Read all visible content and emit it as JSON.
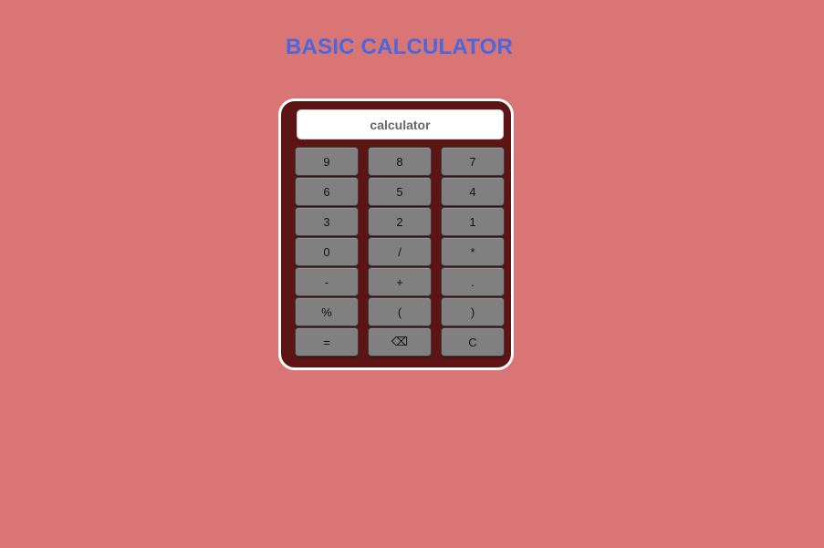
{
  "page": {
    "title": "BASIC CALCULATOR",
    "background_color": "#d97575",
    "title_color": "#4a67df"
  },
  "calculator": {
    "background_color": "#5c1414",
    "display": {
      "placeholder": "calculator",
      "value": ""
    },
    "keys": [
      {
        "label": "9",
        "name": "key-9"
      },
      {
        "label": "8",
        "name": "key-8"
      },
      {
        "label": "7",
        "name": "key-7"
      },
      {
        "label": "6",
        "name": "key-6"
      },
      {
        "label": "5",
        "name": "key-5"
      },
      {
        "label": "4",
        "name": "key-4"
      },
      {
        "label": "3",
        "name": "key-3"
      },
      {
        "label": "2",
        "name": "key-2"
      },
      {
        "label": "1",
        "name": "key-1"
      },
      {
        "label": "0",
        "name": "key-0"
      },
      {
        "label": "/",
        "name": "divide-button"
      },
      {
        "label": "*",
        "name": "multiply-button"
      },
      {
        "label": "-",
        "name": "subtract-button"
      },
      {
        "label": "+",
        "name": "add-button"
      },
      {
        "label": ".",
        "name": "decimal-button"
      },
      {
        "label": "%",
        "name": "percent-button"
      },
      {
        "label": "(",
        "name": "open-paren-button"
      },
      {
        "label": ")",
        "name": "close-paren-button"
      },
      {
        "label": "=",
        "name": "equals-button"
      },
      {
        "label": "⌫",
        "name": "backspace-button"
      },
      {
        "label": "C",
        "name": "clear-button"
      }
    ],
    "key_color": "#808080"
  }
}
